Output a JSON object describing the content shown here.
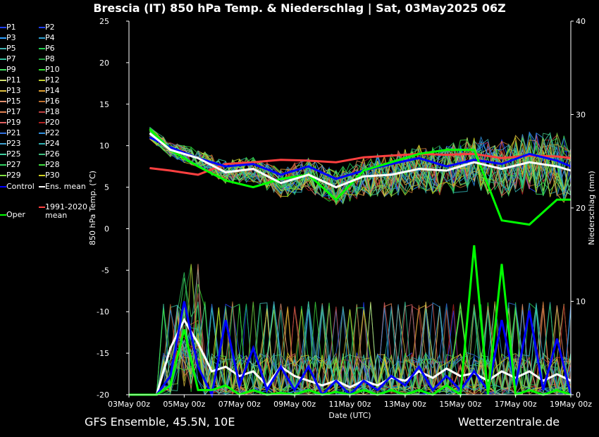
{
  "header": {
    "title": "Brescia  (IT)  850 hPa Temp. & Niederschlag | Sat, 03May2025 06Z"
  },
  "footer": {
    "left": "GFS Ensemble, 45.5N, 10E",
    "right": "Wetterzentrale.de"
  },
  "legend": {
    "members": [
      {
        "label": "P1",
        "color": "#1f3fff"
      },
      {
        "label": "P2",
        "color": "#1f3fff"
      },
      {
        "label": "P3",
        "color": "#2fa0ff"
      },
      {
        "label": "P4",
        "color": "#2f9fd0"
      },
      {
        "label": "P5",
        "color": "#3fb0b0"
      },
      {
        "label": "P6",
        "color": "#20d050"
      },
      {
        "label": "P7",
        "color": "#30c0a0"
      },
      {
        "label": "P8",
        "color": "#20a040"
      },
      {
        "label": "P9",
        "color": "#40e060"
      },
      {
        "label": "P10",
        "color": "#30e030"
      },
      {
        "label": "P11",
        "color": "#d0e070"
      },
      {
        "label": "P12",
        "color": "#c0d030"
      },
      {
        "label": "P13",
        "color": "#e0c040"
      },
      {
        "label": "P14",
        "color": "#e0a030"
      },
      {
        "label": "P15",
        "color": "#e09070"
      },
      {
        "label": "P16",
        "color": "#c07030"
      },
      {
        "label": "P17",
        "color": "#e08050"
      },
      {
        "label": "P18",
        "color": "#c04040"
      },
      {
        "label": "P19",
        "color": "#e06060"
      },
      {
        "label": "P20",
        "color": "#b02020"
      },
      {
        "label": "P21",
        "color": "#3070e0"
      },
      {
        "label": "P22",
        "color": "#3090e0"
      },
      {
        "label": "P23",
        "color": "#40a0d0"
      },
      {
        "label": "P24",
        "color": "#30b0b0"
      },
      {
        "label": "P25",
        "color": "#40d0a0"
      },
      {
        "label": "P26",
        "color": "#40c080"
      },
      {
        "label": "P27",
        "color": "#30d060"
      },
      {
        "label": "P28",
        "color": "#40e040"
      },
      {
        "label": "P29",
        "color": "#80e040"
      },
      {
        "label": "P30",
        "color": "#d0d020"
      }
    ],
    "control": {
      "label": "Control",
      "color": "#0000ff"
    },
    "ens_mean": {
      "label": "Ens. mean",
      "color": "#ffffff"
    },
    "oper": {
      "label": "Oper",
      "color": "#00ff00"
    },
    "clim_line1": "1991-2020",
    "clim_line2": "mean",
    "clim_color": "#ff4040"
  },
  "chart_data": {
    "type": "line",
    "title": "Brescia  (IT)  850 hPa Temp. & Niederschlag | Sat, 03May2025 06Z",
    "xlabel": "Date (UTC)",
    "ylabel_left": "850 hPa Temp. (°C)",
    "ylabel_right": "Niederschlag (mm)",
    "ylim_left": [
      -20,
      25
    ],
    "ylim_right": [
      0,
      40
    ],
    "yticks_left": [
      -20,
      -15,
      -10,
      -5,
      0,
      5,
      10,
      15,
      20,
      25
    ],
    "yticks_right": [
      0,
      10,
      20,
      30,
      40
    ],
    "x_categories": [
      "03May 00z",
      "05May 00z",
      "07May 00z",
      "09May 00z",
      "11May 00z",
      "13May 00z",
      "15May 00z",
      "17May 00z",
      "19May 00z"
    ],
    "x_range_days": [
      0,
      16
    ],
    "grid": false,
    "series": [
      {
        "name": "Ens. mean",
        "axis": "left",
        "color": "#ffffff",
        "x": [
          0.75,
          1.5,
          2.5,
          3.5,
          4.5,
          5.5,
          6.5,
          7.5,
          8.5,
          9.5,
          10.5,
          11.5,
          12.5,
          13.5,
          14.5,
          15.5,
          16
        ],
        "values": [
          11.5,
          9.5,
          8.5,
          6.8,
          7.2,
          5.5,
          6.5,
          5.0,
          6.3,
          6.5,
          7.2,
          7.0,
          8.0,
          7.2,
          8.0,
          7.5,
          7.0
        ]
      },
      {
        "name": "Control",
        "axis": "left",
        "color": "#0000ff",
        "x": [
          0.75,
          1.5,
          2.5,
          3.5,
          4.5,
          5.5,
          6.5,
          7.5,
          8.5,
          9.5,
          10.5,
          11.5,
          12.5,
          13.5,
          14.5,
          15.5,
          16
        ],
        "values": [
          11.0,
          9.8,
          8.5,
          7.5,
          7.8,
          6.5,
          7.5,
          6.0,
          7.0,
          7.8,
          8.5,
          7.5,
          8.3,
          7.8,
          9.0,
          8.2,
          7.5
        ]
      },
      {
        "name": "Oper",
        "axis": "left",
        "color": "#00ff00",
        "x": [
          0.75,
          1.5,
          2.5,
          3.5,
          4.5,
          5.5,
          6.5,
          7.5,
          8.5,
          9.5,
          10.5,
          11.5,
          12.5,
          13.5,
          14.5,
          15.5,
          16
        ],
        "values": [
          12.0,
          9.5,
          7.5,
          5.8,
          5.0,
          6.0,
          6.5,
          3.5,
          7.0,
          8.0,
          9.0,
          9.5,
          9.5,
          1.0,
          0.5,
          3.5,
          3.5
        ]
      },
      {
        "name": "1991-2020 mean",
        "axis": "left",
        "color": "#ff4040",
        "x": [
          0.75,
          1.5,
          2.5,
          3.5,
          4.5,
          5.5,
          6.5,
          7.5,
          8.5,
          9.5,
          10.5,
          11.5,
          12.5,
          13.5,
          14.5,
          15.5,
          16
        ],
        "values": [
          7.3,
          7.0,
          6.5,
          7.8,
          8.0,
          8.3,
          8.2,
          8.0,
          8.6,
          8.8,
          9.0,
          8.9,
          9.0,
          8.5,
          8.8,
          8.7,
          8.5
        ]
      },
      {
        "name": "Ens. mean",
        "axis": "right",
        "color": "#ffffff",
        "x": [
          0,
          1,
          1.5,
          2,
          2.5,
          3,
          3.5,
          4,
          4.5,
          5,
          5.5,
          6,
          6.5,
          7,
          7.5,
          8,
          8.5,
          9,
          9.5,
          10,
          10.5,
          11,
          11.5,
          12,
          12.5,
          13,
          13.5,
          14,
          14.5,
          15,
          15.5,
          16
        ],
        "values": [
          0,
          0,
          5,
          8,
          5.5,
          2.5,
          3,
          2,
          2.5,
          1,
          3,
          2,
          1.5,
          1,
          1.5,
          0.8,
          1.5,
          1,
          1.8,
          1.5,
          2.5,
          1.8,
          2.8,
          2,
          2.3,
          1.5,
          2.5,
          1.8,
          2.5,
          1.5,
          2.2,
          1.5
        ]
      },
      {
        "name": "Control",
        "axis": "right",
        "color": "#0000ff",
        "x": [
          0,
          1,
          1.5,
          2,
          2.5,
          3,
          3.5,
          4,
          4.5,
          5,
          5.5,
          6,
          6.5,
          7,
          7.5,
          8,
          8.5,
          9,
          9.5,
          10,
          10.5,
          11,
          11.5,
          12,
          12.5,
          13,
          13.5,
          14,
          14.5,
          15,
          15.5,
          16
        ],
        "values": [
          0,
          0,
          2,
          10,
          3,
          0,
          8,
          1,
          5,
          0.5,
          3,
          0.5,
          3,
          0,
          1.5,
          0,
          1.5,
          0.5,
          2,
          1,
          3,
          0.5,
          2,
          0.5,
          2.5,
          0.5,
          8,
          1,
          9,
          0.5,
          6,
          0
        ]
      },
      {
        "name": "Oper",
        "axis": "right",
        "color": "#00ff00",
        "x": [
          0,
          1,
          1.5,
          2,
          2.5,
          3,
          3.5,
          4,
          4.5,
          5,
          5.5,
          6,
          6.5,
          7,
          7.5,
          8,
          8.5,
          9,
          9.5,
          10,
          10.5,
          11,
          11.5,
          12,
          12.5,
          13,
          13.5,
          14,
          14.5,
          15,
          15.5,
          16
        ],
        "values": [
          0,
          0,
          1,
          7,
          0.5,
          0.5,
          1,
          0,
          0.5,
          0,
          0.2,
          0,
          0.5,
          0,
          0.3,
          0,
          0.5,
          0,
          0.5,
          0,
          0.5,
          0,
          1,
          0,
          16,
          0,
          14,
          0,
          0.5,
          0,
          0.5,
          0
        ]
      }
    ],
    "member_spread": {
      "axis_left_range": [
        -1,
        13
      ],
      "axis_right_range": [
        0,
        22
      ]
    }
  }
}
